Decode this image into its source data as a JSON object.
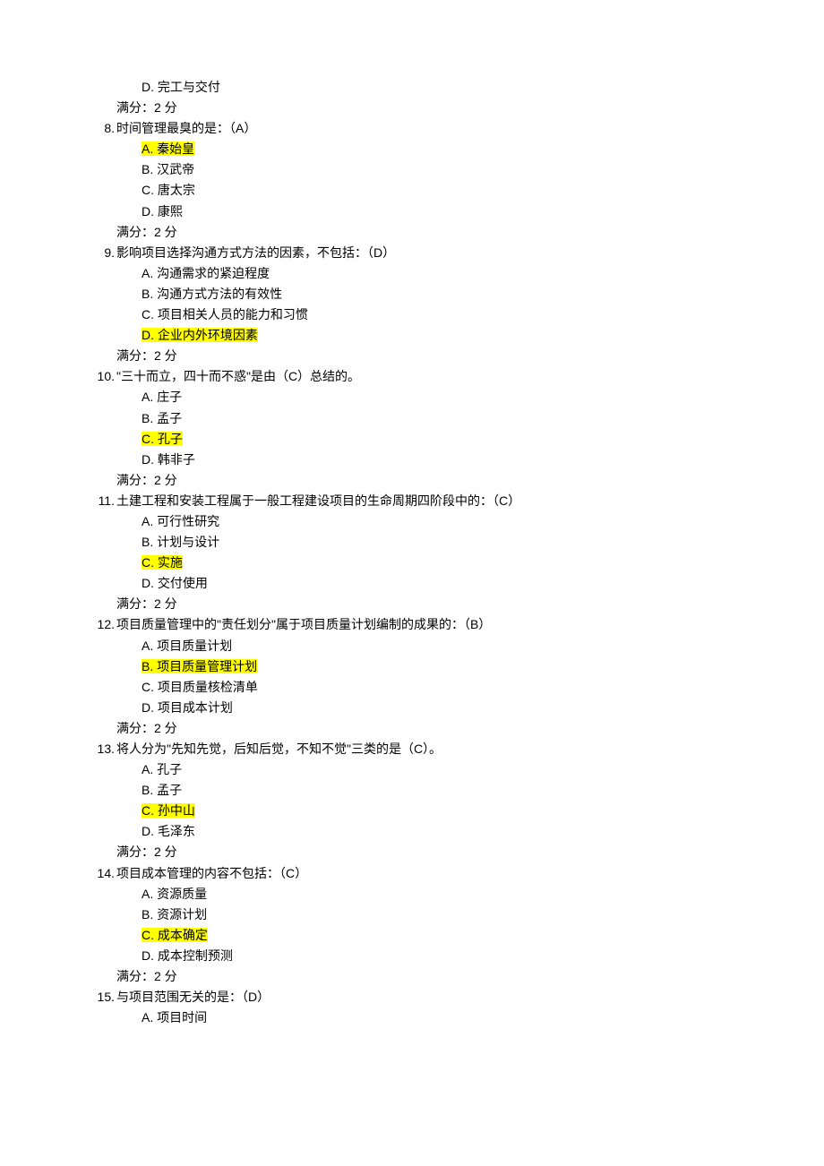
{
  "items": [
    {
      "type": "opt",
      "text": "D. 完工与交付"
    },
    {
      "type": "score",
      "text": "满分：2 分"
    },
    {
      "type": "q",
      "num": "8.",
      "text": "时间管理最臭的是：（A）"
    },
    {
      "type": "opt",
      "text": "A. 秦始皇",
      "hl": true
    },
    {
      "type": "opt",
      "text": "B. 汉武帝"
    },
    {
      "type": "opt",
      "text": "C. 唐太宗"
    },
    {
      "type": "opt",
      "text": "D. 康熙"
    },
    {
      "type": "score",
      "text": "满分：2 分"
    },
    {
      "type": "q",
      "num": "9.",
      "text": "影响项目选择沟通方式方法的因素，不包括：（D）"
    },
    {
      "type": "opt",
      "text": "A. 沟通需求的紧迫程度"
    },
    {
      "type": "opt",
      "text": "B. 沟通方式方法的有效性"
    },
    {
      "type": "opt",
      "text": "C. 项目相关人员的能力和习惯"
    },
    {
      "type": "opt",
      "text": "D. 企业内外环境因素",
      "hl": true
    },
    {
      "type": "score",
      "text": "满分：2 分"
    },
    {
      "type": "q",
      "num": "10.",
      "text": "\"三十而立，四十而不惑\"是由（C）总结的。",
      "wide": true
    },
    {
      "type": "opt",
      "text": "A. 庄子"
    },
    {
      "type": "opt",
      "text": "B. 孟子"
    },
    {
      "type": "opt",
      "text": "C. 孔子",
      "hl": true
    },
    {
      "type": "opt",
      "text": "D. 韩非子"
    },
    {
      "type": "score",
      "text": "满分：2 分"
    },
    {
      "type": "q",
      "num": "11.",
      "text": "土建工程和安装工程属于一般工程建设项目的生命周期四阶段中的：（C）",
      "wide": true
    },
    {
      "type": "opt",
      "text": "A. 可行性研究"
    },
    {
      "type": "opt",
      "text": "B. 计划与设计"
    },
    {
      "type": "opt",
      "text": "C. 实施",
      "hl": true
    },
    {
      "type": "opt",
      "text": "D. 交付使用"
    },
    {
      "type": "score",
      "text": "满分：2 分"
    },
    {
      "type": "q",
      "num": "12.",
      "text": "项目质量管理中的\"责任划分\"属于项目质量计划编制的成果的：（B）",
      "wide": true
    },
    {
      "type": "opt",
      "text": "A. 项目质量计划"
    },
    {
      "type": "opt",
      "text": "B. 项目质量管理计划",
      "hl": true
    },
    {
      "type": "opt",
      "text": "C. 项目质量核检清单"
    },
    {
      "type": "opt",
      "text": "D. 项目成本计划"
    },
    {
      "type": "score",
      "text": "满分：2 分"
    },
    {
      "type": "q",
      "num": "13.",
      "text": "将人分为\"先知先觉，后知后觉，不知不觉\"三类的是（C）。",
      "wide": true
    },
    {
      "type": "opt",
      "text": "A. 孔子"
    },
    {
      "type": "opt",
      "text": "B. 孟子"
    },
    {
      "type": "opt",
      "text": "C. 孙中山",
      "hl": true
    },
    {
      "type": "opt",
      "text": "D. 毛泽东"
    },
    {
      "type": "score",
      "text": "满分：2 分"
    },
    {
      "type": "q",
      "num": "14.",
      "text": "项目成本管理的内容不包括：（C）",
      "wide": true
    },
    {
      "type": "opt",
      "text": "A. 资源质量"
    },
    {
      "type": "opt",
      "text": "B. 资源计划"
    },
    {
      "type": "opt",
      "text": "C. 成本确定",
      "hl": true
    },
    {
      "type": "opt",
      "text": "D. 成本控制预测"
    },
    {
      "type": "score",
      "text": "满分：2 分"
    },
    {
      "type": "q",
      "num": "15.",
      "text": "与项目范围无关的是：（D）",
      "wide": true
    },
    {
      "type": "opt",
      "text": "A. 项目时间"
    }
  ]
}
